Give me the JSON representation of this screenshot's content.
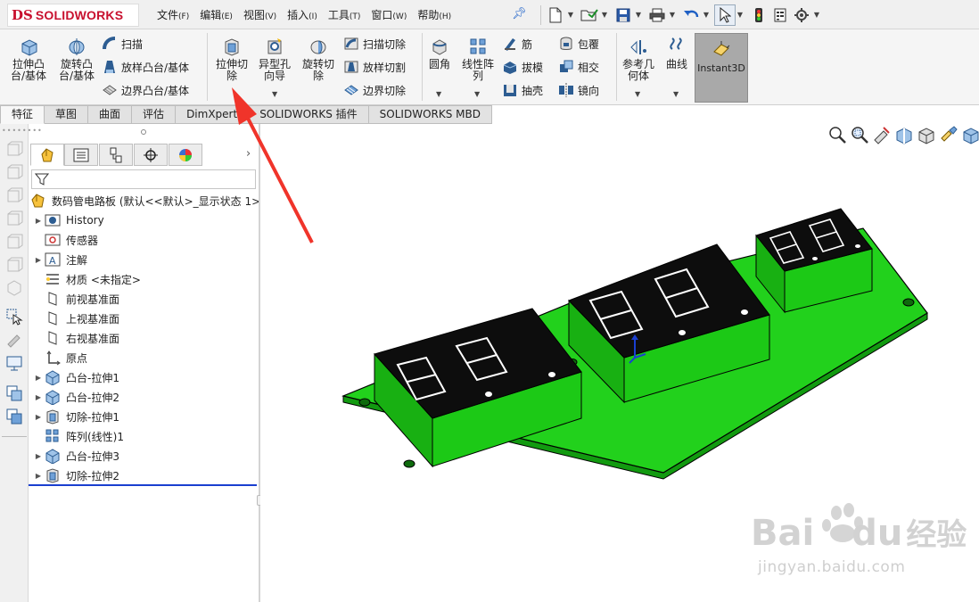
{
  "app": {
    "logo_mark": "DS",
    "logo_name": "SOLIDWORKS"
  },
  "menu": [
    {
      "label": "文件",
      "key": "(F)"
    },
    {
      "label": "编辑",
      "key": "(E)"
    },
    {
      "label": "视图",
      "key": "(V)"
    },
    {
      "label": "插入",
      "key": "(I)"
    },
    {
      "label": "工具",
      "key": "(T)"
    },
    {
      "label": "窗口",
      "key": "(W)"
    },
    {
      "label": "帮助",
      "key": "(H)"
    }
  ],
  "quick_access_icons": [
    "new-document-icon",
    "open-icon",
    "save-icon",
    "print-icon",
    "undo-icon",
    "select-icon",
    "traffic-light-icon",
    "file-properties-icon",
    "options-gear-icon"
  ],
  "ribbon": {
    "extrude_boss": "拉伸凸\n台/基体",
    "revolve_boss": "旋转凸\n台/基体",
    "sweep": "扫描",
    "loft_boss": "放样凸台/基体",
    "boundary_boss": "边界凸台/基体",
    "extrude_cut": "拉伸切\n除",
    "hole_wizard": "异型孔\n向导",
    "revolve_cut": "旋转切\n除",
    "swept_cut": "扫描切除",
    "lofted_cut": "放样切割",
    "boundary_cut": "边界切除",
    "fillet": "圆角",
    "linear_pattern": "线性阵\n列",
    "rib": "筋",
    "draft": "拔模",
    "shell": "抽壳",
    "wrap": "包覆",
    "intersect": "相交",
    "mirror": "镜向",
    "ref_geometry": "参考几\n何体",
    "curves": "曲线",
    "instant3d": "Instant3D"
  },
  "tabs": [
    "特征",
    "草图",
    "曲面",
    "评估",
    "DimXpert",
    "SOLIDWORKS 插件",
    "SOLIDWORKS MBD"
  ],
  "tree": {
    "root": "数码管电路板 (默认<<默认>_显示状态 1>",
    "items": [
      {
        "label": "History",
        "icon": "history-folder-icon",
        "expandable": true
      },
      {
        "label": "传感器",
        "icon": "sensor-icon",
        "expandable": false
      },
      {
        "label": "注解",
        "icon": "annotation-icon",
        "expandable": true
      },
      {
        "label": "材质 <未指定>",
        "icon": "material-icon",
        "expandable": false
      },
      {
        "label": "前视基准面",
        "icon": "plane-icon",
        "expandable": false
      },
      {
        "label": "上视基准面",
        "icon": "plane-icon",
        "expandable": false
      },
      {
        "label": "右视基准面",
        "icon": "plane-icon",
        "expandable": false
      },
      {
        "label": "原点",
        "icon": "origin-icon",
        "expandable": false
      },
      {
        "label": "凸台-拉伸1",
        "icon": "boss-extrude-icon",
        "expandable": true
      },
      {
        "label": "凸台-拉伸2",
        "icon": "boss-extrude-icon",
        "expandable": true
      },
      {
        "label": "切除-拉伸1",
        "icon": "cut-extrude-icon",
        "expandable": true
      },
      {
        "label": "阵列(线性)1",
        "icon": "linear-pattern-icon",
        "expandable": false
      },
      {
        "label": "凸台-拉伸3",
        "icon": "boss-extrude-icon",
        "expandable": true
      },
      {
        "label": "切除-拉伸2",
        "icon": "cut-extrude-icon",
        "expandable": true
      }
    ]
  },
  "colors": {
    "brand_red": "#c8102e",
    "board_green": "#22d11c",
    "display_black": "#0d0d0d",
    "annotation_arrow": "#f0342a",
    "rollback_bar": "#1a3fd0"
  },
  "watermark": {
    "brand": "Bai",
    "brand2": "du",
    "cn": "经验",
    "url": "jingyan.baidu.com"
  }
}
